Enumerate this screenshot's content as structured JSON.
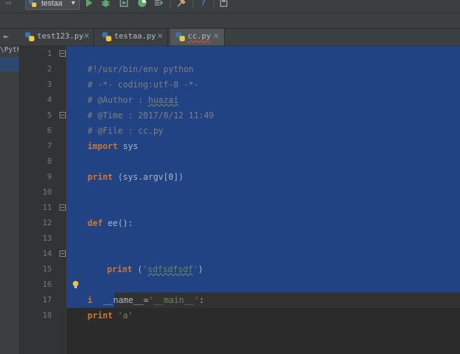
{
  "toolbar": {
    "run_config_label": "testaa",
    "icons": [
      "run-icon",
      "debug-icon",
      "coverage-icon",
      "profile-icon",
      "concurrency-icon",
      "settings-icon",
      "help-icon",
      "sdk-icon"
    ]
  },
  "project": {
    "path_fragment": "\\Pyth"
  },
  "tabs": [
    {
      "label": "test123.py",
      "active": false
    },
    {
      "label": "testaa.py",
      "active": false
    },
    {
      "label": "cc.py",
      "active": true
    }
  ],
  "editor": {
    "line_numbers": [
      "1",
      "2",
      "3",
      "4",
      "5",
      "6",
      "7",
      "8",
      "9",
      "10",
      "11",
      "12",
      "13",
      "14",
      "15",
      "16",
      "17",
      "18"
    ],
    "lines": {
      "l1": "#!/usr/bin/env python",
      "l2": "# -*- coding:utf-8 -*-",
      "l3a": "# @Author : ",
      "l3b": "huazai",
      "l4": "# @Time : 2017/8/12 11:49",
      "l5": "# @File : cc.py",
      "l6kw": "import",
      "l6rest": " sys",
      "l8kw": "print",
      "l8rest": " (sys.argv[0])",
      "l11kw": "def",
      "l11rest": " ee():",
      "l14kw": "print",
      "l14a": " (",
      "l14q1": "'",
      "l14s": "sdfsdfsdf",
      "l14q2": "'",
      "l14b": ")",
      "l16a": "i",
      "l16b": "__name__=",
      "l16s": "'__main__'",
      "l16c": ":",
      "l17kw": "print",
      "l17s": " 'a'"
    }
  },
  "colors": {
    "selection": "#214283",
    "keyword": "#cc7832",
    "comment": "#808080",
    "string": "#6a8759"
  }
}
